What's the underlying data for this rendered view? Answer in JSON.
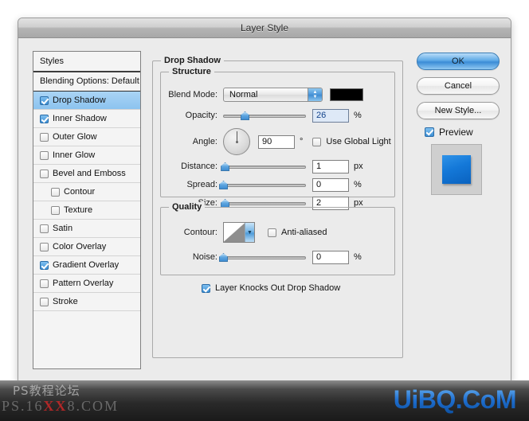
{
  "window": {
    "title": "Layer Style"
  },
  "styles_panel": {
    "header": "Styles",
    "blending_options": "Blending Options: Default",
    "items": [
      {
        "label": "Drop Shadow",
        "checked": true,
        "selected": true,
        "indent": false
      },
      {
        "label": "Inner Shadow",
        "checked": true,
        "selected": false,
        "indent": false
      },
      {
        "label": "Outer Glow",
        "checked": false,
        "selected": false,
        "indent": false
      },
      {
        "label": "Inner Glow",
        "checked": false,
        "selected": false,
        "indent": false
      },
      {
        "label": "Bevel and Emboss",
        "checked": false,
        "selected": false,
        "indent": false
      },
      {
        "label": "Contour",
        "checked": false,
        "selected": false,
        "indent": true
      },
      {
        "label": "Texture",
        "checked": false,
        "selected": false,
        "indent": true
      },
      {
        "label": "Satin",
        "checked": false,
        "selected": false,
        "indent": false
      },
      {
        "label": "Color Overlay",
        "checked": false,
        "selected": false,
        "indent": false
      },
      {
        "label": "Gradient Overlay",
        "checked": true,
        "selected": false,
        "indent": false
      },
      {
        "label": "Pattern Overlay",
        "checked": false,
        "selected": false,
        "indent": false
      },
      {
        "label": "Stroke",
        "checked": false,
        "selected": false,
        "indent": false
      }
    ]
  },
  "drop_shadow": {
    "group_title": "Drop Shadow",
    "structure": {
      "group_title": "Structure",
      "blend_mode_label": "Blend Mode:",
      "blend_mode_value": "Normal",
      "shadow_color": "#000000",
      "opacity_label": "Opacity:",
      "opacity_value": "26",
      "opacity_unit": "%",
      "opacity_percent": 26,
      "angle_label": "Angle:",
      "angle_value": "90",
      "angle_unit": "°",
      "use_global_light_label": "Use Global Light",
      "use_global_light_checked": false,
      "distance_label": "Distance:",
      "distance_value": "1",
      "distance_unit": "px",
      "distance_percent": 2,
      "spread_label": "Spread:",
      "spread_value": "0",
      "spread_unit": "%",
      "spread_percent": 0,
      "size_label": "Size:",
      "size_value": "2",
      "size_unit": "px",
      "size_percent": 2
    },
    "quality": {
      "group_title": "Quality",
      "contour_label": "Contour:",
      "anti_aliased_label": "Anti-aliased",
      "anti_aliased_checked": false,
      "noise_label": "Noise:",
      "noise_value": "0",
      "noise_unit": "%",
      "noise_percent": 0
    },
    "knockout_label": "Layer Knocks Out Drop Shadow",
    "knockout_checked": true
  },
  "buttons": {
    "ok": "OK",
    "cancel": "Cancel",
    "new_style": "New Style...",
    "preview_label": "Preview",
    "preview_checked": true,
    "preview_color": "#1478d8"
  },
  "watermark": {
    "left_top": "PS教程论坛",
    "left_bottom_pre": "PS.16",
    "left_bottom_red": "XX",
    "left_bottom_post": "8.COM",
    "right": "UiBQ.CoM",
    "right_color": "#1f6fd0"
  }
}
